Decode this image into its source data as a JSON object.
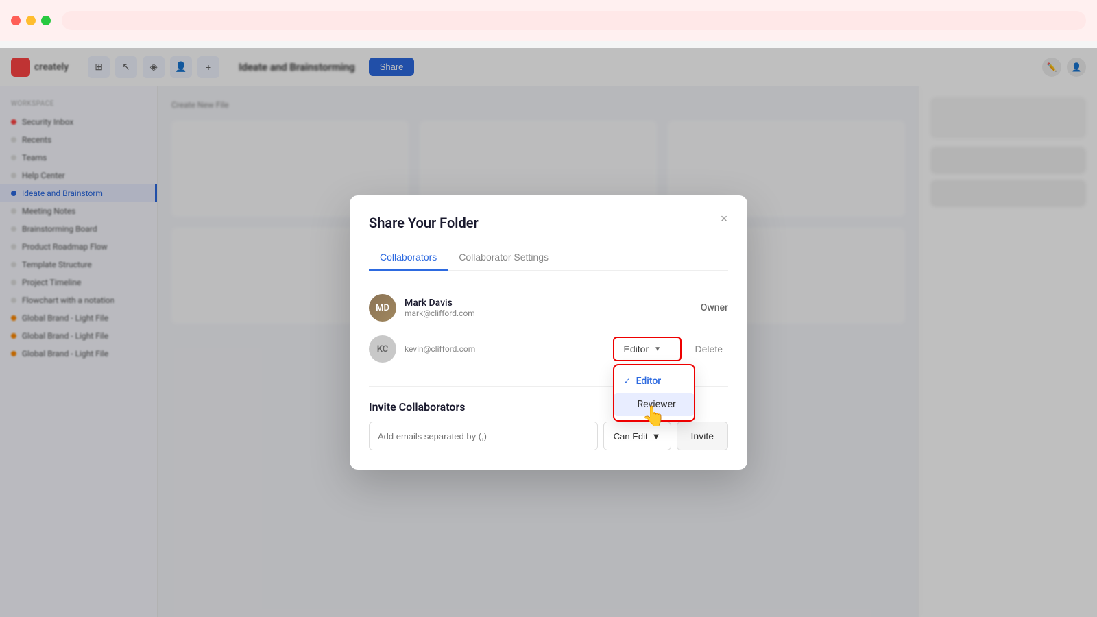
{
  "topBar": {
    "trafficLights": [
      "red",
      "yellow",
      "green"
    ]
  },
  "header": {
    "logo": "creately",
    "docTitle": "Ideate and Brainstorming",
    "shareLabel": "Share",
    "tools": [
      "grid-icon",
      "cursor-icon",
      "layers-icon",
      "users-icon",
      "plus-icon"
    ]
  },
  "sidebar": {
    "sectionLabel": "Workspace",
    "items": [
      {
        "label": "Security Inbox",
        "icon": "shield-icon",
        "active": false
      },
      {
        "label": "Recents",
        "icon": "clock-icon",
        "active": false
      },
      {
        "label": "Teams",
        "icon": "team-icon",
        "active": false
      },
      {
        "label": "Help Center",
        "icon": "help-icon",
        "active": false
      },
      {
        "label": "Ideate and Brainstorm",
        "icon": "folder-icon",
        "active": true
      },
      {
        "label": "Meeting Notes",
        "icon": "file-icon",
        "active": false
      },
      {
        "label": "Brainstorming Board",
        "icon": "file-icon",
        "active": false
      },
      {
        "label": "Product Roadmap Flow",
        "icon": "file-icon",
        "active": false
      },
      {
        "label": "Template Structure",
        "icon": "file-icon",
        "active": false
      },
      {
        "label": "Project Timeline",
        "icon": "file-icon",
        "active": false
      },
      {
        "label": "Flowchart with a notation",
        "icon": "file-icon",
        "active": false
      },
      {
        "label": "Global Brand - Light File",
        "icon": "file-icon",
        "active": false
      },
      {
        "label": "Global Brand - Light File",
        "icon": "file-icon",
        "active": false
      },
      {
        "label": "Global Brand - Light File",
        "icon": "file-icon",
        "active": false
      }
    ]
  },
  "modal": {
    "title": "Share Your Folder",
    "closeLabel": "×",
    "tabs": [
      {
        "label": "Collaborators",
        "active": true
      },
      {
        "label": "Collaborator Settings",
        "active": false
      }
    ],
    "collaborators": [
      {
        "name": "Mark Davis",
        "email": "mark@clifford.com",
        "role": "Owner",
        "hasAvatar": true,
        "avatarInitial": "MD"
      },
      {
        "name": "",
        "email": "kevin@clifford.com",
        "role": "Editor",
        "hasAvatar": false,
        "avatarInitial": "KC"
      }
    ],
    "roleDropdown": {
      "currentRole": "Editor",
      "options": [
        {
          "label": "Editor",
          "selected": true
        },
        {
          "label": "Reviewer",
          "selected": false,
          "highlighted": true
        }
      ]
    },
    "deleteLabel": "Delete",
    "inviteSection": {
      "title": "Invite Collaborators",
      "inputPlaceholder": "Add emails separated by (,)",
      "permissionLabel": "Can Edit",
      "inviteButtonLabel": "Invite"
    }
  }
}
